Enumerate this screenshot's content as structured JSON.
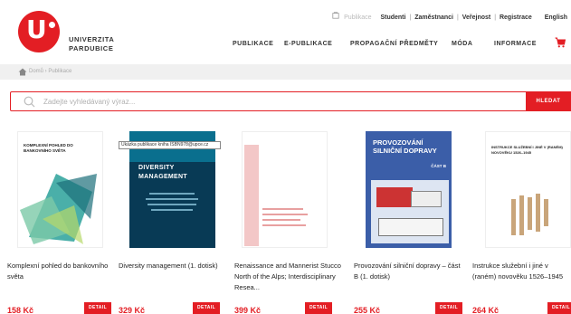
{
  "logo": {
    "line1": "UNIVERZITA",
    "line2": "PARDUBICE"
  },
  "toplinks": {
    "publish": "Publikace",
    "links": [
      "Studenti",
      "Zaměstnanci",
      "Veřejnost",
      "Registrace"
    ],
    "separator": "|",
    "language": "English"
  },
  "nav": {
    "items": [
      "PUBLIKACE",
      "E-PUBLIKACE",
      "PROPAGAČNÍ PŘEDMĚTY",
      "MÓDA",
      "INFORMACE"
    ]
  },
  "breadcrumb": "Domů › Publikace",
  "search": {
    "placeholder": "Zadejte vyhledávaný výraz...",
    "button": "HLEDAT"
  },
  "tooltip": "Ukázka publikace kniha ISBN978@upce.cz",
  "products": [
    {
      "title": "Komplexní pohled do bankovního světa",
      "price": "158 Kč",
      "detail": "DETAIL",
      "cover": {
        "title": "KOMPLEXNÍ POHLED DO BANKOVNÍHO SVĚTA",
        "bg": "#ffffff",
        "accent": "#2aa19a"
      }
    },
    {
      "title": "Diversity management (1. dotisk)",
      "price": "329 Kč",
      "detail": "DETAIL",
      "cover": {
        "title": "DIVERSITY MANAGEMENT",
        "bg": "#083a55",
        "accent": "#0a6f8e"
      }
    },
    {
      "title": "Renaissance and Mannerist Stucco North of the Alps; Interdisciplinary Resea...",
      "price": "399 Kč",
      "detail": "DETAIL",
      "cover": {
        "title": "",
        "bg": "#f3c7c7",
        "accent": "#e8a0a0"
      }
    },
    {
      "title": "Provozování silniční dopravy – část B (1. dotisk)",
      "price": "255 Kč",
      "detail": "DETAIL",
      "cover": {
        "title": "PROVOZOVÁNÍ SILNIČNÍ DOPRAVY",
        "part": "ČÁST B",
        "bg": "#3b5ea8",
        "accent": "#6c8bd0"
      }
    },
    {
      "title": "Instrukce služební i jiné v (raném) novověku 1526–1945",
      "price": "264 Kč",
      "detail": "DETAIL",
      "cover": {
        "title": "INSTRUKCE SLUŽEBNÍ I JINÉ V (RANÉM) NOVOVĚKU 1526–1945",
        "bg": "#ffffff",
        "accent": "#c9a57a"
      }
    }
  ],
  "colors": {
    "brand": "#e31e24",
    "text": "#333333"
  }
}
